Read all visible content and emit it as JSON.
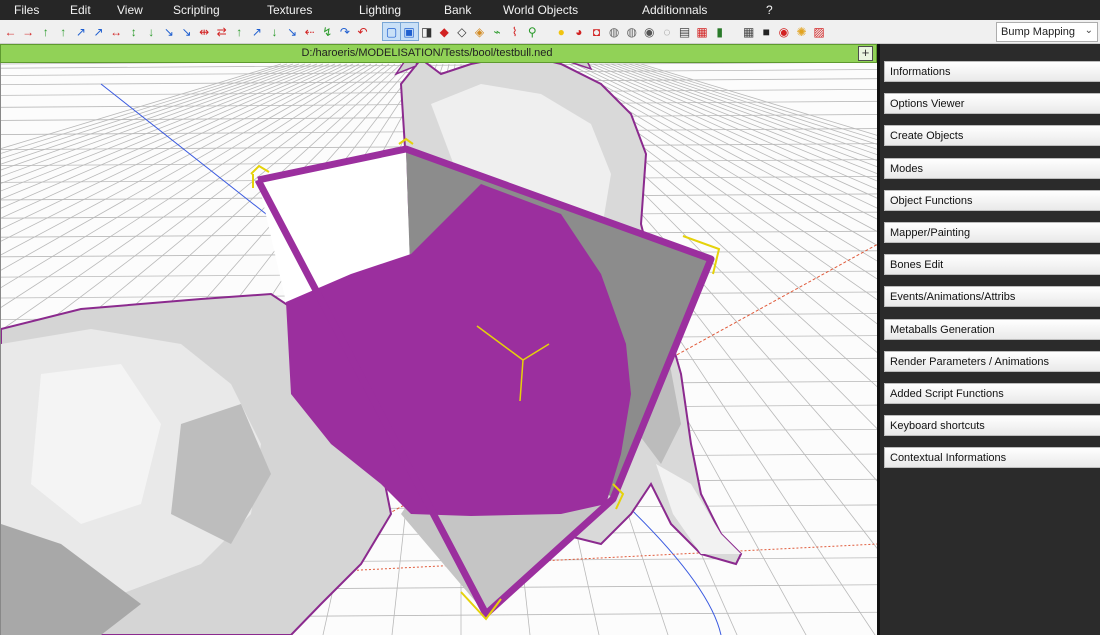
{
  "menu": [
    "Files",
    "Edit",
    "View",
    "Scripting",
    "Textures",
    "Lighting",
    "Bank",
    "World Objects",
    "Additionnals",
    "?"
  ],
  "toolbar": {
    "icons": [
      {
        "name": "undo-arrow-icon",
        "glyph": "←",
        "color": "#d22222"
      },
      {
        "name": "redo-arrow-icon",
        "glyph": "→",
        "color": "#d22222"
      },
      {
        "name": "move-up-icon",
        "glyph": "↑",
        "color": "#2a9a2a"
      },
      {
        "name": "move-up-alt-icon",
        "glyph": "↑",
        "color": "#2a9a2a"
      },
      {
        "name": "rotate-axis-icon",
        "glyph": "↗",
        "color": "#1f5fd0"
      },
      {
        "name": "rotate-axis-alt-icon",
        "glyph": "↗",
        "color": "#1f5fd0"
      },
      {
        "name": "scale-x-icon",
        "glyph": "↔",
        "color": "#d22222"
      },
      {
        "name": "scale-y-icon",
        "glyph": "↕",
        "color": "#2a9a2a"
      },
      {
        "name": "axis-move-icon",
        "glyph": "↓",
        "color": "#2a9a2a"
      },
      {
        "name": "axis-rotate-icon",
        "glyph": "↘",
        "color": "#1f5fd0"
      },
      {
        "name": "axis-scale-icon",
        "glyph": "↘",
        "color": "#1f5fd0"
      },
      {
        "name": "split-icon",
        "glyph": "⇹",
        "color": "#d22222"
      },
      {
        "name": "merge-icon",
        "glyph": "⇄",
        "color": "#d22222"
      },
      {
        "name": "snap-up-icon",
        "glyph": "↑",
        "color": "#2a9a2a"
      },
      {
        "name": "snap-rotate-icon",
        "glyph": "↗",
        "color": "#1f5fd0"
      },
      {
        "name": "snap-down-icon",
        "glyph": "↓",
        "color": "#2a9a2a"
      },
      {
        "name": "snap-diagonal-icon",
        "glyph": "↘",
        "color": "#1f5fd0"
      },
      {
        "name": "extrude-icon",
        "glyph": "⇠",
        "color": "#d22222"
      },
      {
        "name": "bevel-icon",
        "glyph": "↯",
        "color": "#2a9a2a"
      },
      {
        "name": "curve-icon",
        "glyph": "↷",
        "color": "#1f5fd0"
      },
      {
        "name": "curve-alt-icon",
        "glyph": "↶",
        "color": "#d22222"
      },
      {
        "name": "select-mode-icon",
        "glyph": "▢",
        "color": "#1f5fd0"
      },
      {
        "name": "face-mode-icon",
        "glyph": "▣",
        "color": "#1f5fd0"
      },
      {
        "name": "cube-icon",
        "glyph": "◨",
        "color": "#333333"
      },
      {
        "name": "cone-red-icon",
        "glyph": "◆",
        "color": "#d22222"
      },
      {
        "name": "cone-icon",
        "glyph": "◇",
        "color": "#333333"
      },
      {
        "name": "diamond-icon",
        "glyph": "◈",
        "color": "#d28a22"
      },
      {
        "name": "vertex-icon",
        "glyph": "⌁",
        "color": "#2a9a2a"
      },
      {
        "name": "edge-icon",
        "glyph": "⌇",
        "color": "#d22222"
      },
      {
        "name": "skeleton-icon",
        "glyph": "⚲",
        "color": "#2a9a2a"
      },
      {
        "name": "lightbulb-icon",
        "glyph": "●",
        "color": "#f1c40f"
      },
      {
        "name": "paint-bucket-icon",
        "glyph": "◕",
        "color": "#d22222"
      },
      {
        "name": "paint-icon",
        "glyph": "◘",
        "color": "#d22222"
      },
      {
        "name": "mesh-icon",
        "glyph": "◍",
        "color": "#666666"
      },
      {
        "name": "mesh-alt-icon",
        "glyph": "◍",
        "color": "#666666"
      },
      {
        "name": "mesh-dark-icon",
        "glyph": "◉",
        "color": "#555555"
      },
      {
        "name": "mesh-light-icon",
        "glyph": "◌",
        "color": "#777777"
      },
      {
        "name": "texture-icon",
        "glyph": "▤",
        "color": "#444444"
      },
      {
        "name": "material-icon",
        "glyph": "▦",
        "color": "#d22222"
      },
      {
        "name": "bottle-icon",
        "glyph": "▮",
        "color": "#2a7a2a"
      },
      {
        "name": "clapper-icon",
        "glyph": "▦",
        "color": "#444444"
      },
      {
        "name": "film-icon",
        "glyph": "■",
        "color": "#222222"
      },
      {
        "name": "record-icon",
        "glyph": "◉",
        "color": "#d22222"
      },
      {
        "name": "gear-icon",
        "glyph": "✺",
        "color": "#e2a31f"
      },
      {
        "name": "export-icon",
        "glyph": "▨",
        "color": "#d22222"
      }
    ],
    "render_mode": "Bump Mapping"
  },
  "viewport": {
    "file_path": "D:/haroeris/MODELISATION/Tests/bool/testbull.ned",
    "add_view_label": "+"
  },
  "panel": {
    "buttons": [
      "Informations",
      "Options Viewer",
      "Create Objects",
      "Modes",
      "Object Functions",
      "Mapper/Painting",
      "Bones Edit",
      "Events/Animations/Attribs",
      "Metaballs Generation",
      "Render Parameters / Animations",
      "Added Script Functions",
      "Keyboard shortcuts",
      "Contextual Informations"
    ]
  },
  "colors": {
    "selection": "#9b2f9e",
    "axis_gizmo": "#e5d20a",
    "grid": "#b9b9b9",
    "path_bar": "#91d257",
    "x_axis": "#e05a3a",
    "z_axis": "#3a5ae0"
  }
}
